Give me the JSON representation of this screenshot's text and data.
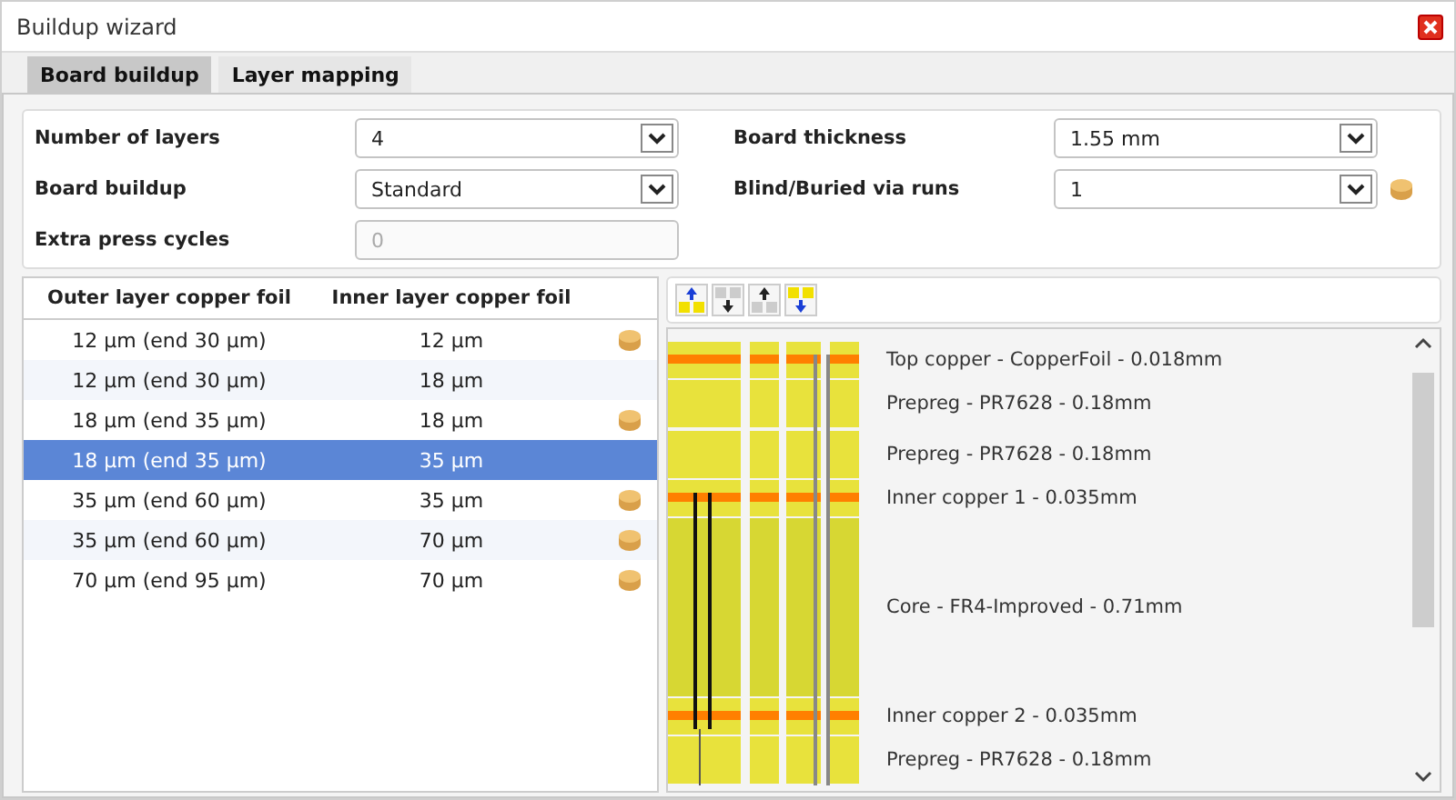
{
  "window": {
    "title": "Buildup wizard"
  },
  "tabs": [
    {
      "label": "Board buildup",
      "selected": true
    },
    {
      "label": "Layer mapping",
      "selected": false
    }
  ],
  "settings": [
    {
      "label": "Number of layers",
      "kind": "select",
      "value": "4",
      "disabled": false,
      "coin": false
    },
    {
      "label": "Board thickness",
      "kind": "select",
      "value": "1.55 mm",
      "disabled": false,
      "coin": false
    },
    {
      "label": "Board buildup",
      "kind": "select",
      "value": "Standard",
      "disabled": false,
      "coin": false
    },
    {
      "label": "Blind/Buried via runs",
      "kind": "select",
      "value": "1",
      "disabled": false,
      "coin": true
    },
    {
      "label": "Extra press cycles",
      "kind": "input",
      "value": "0",
      "disabled": true,
      "coin": false
    }
  ],
  "table": {
    "columns": [
      "Outer layer copper foil",
      "Inner layer copper foil"
    ],
    "rows": [
      {
        "cells": [
          "12 µm (end 30 µm)",
          "12 µm"
        ],
        "coin": true,
        "selected": false
      },
      {
        "cells": [
          "12 µm (end 30 µm)",
          "18 µm"
        ],
        "coin": false,
        "selected": false
      },
      {
        "cells": [
          "18 µm (end 35 µm)",
          "18 µm"
        ],
        "coin": true,
        "selected": false
      },
      {
        "cells": [
          "18 µm (end 35 µm)",
          "35 µm"
        ],
        "coin": false,
        "selected": true
      },
      {
        "cells": [
          "35 µm (end 60 µm)",
          "35 µm"
        ],
        "coin": true,
        "selected": false
      },
      {
        "cells": [
          "35 µm (end 60 µm)",
          "70 µm"
        ],
        "coin": true,
        "selected": false
      },
      {
        "cells": [
          "70 µm (end 95 µm)",
          "70 µm"
        ],
        "coin": true,
        "selected": false
      }
    ]
  },
  "stack": {
    "layers": [
      {
        "kind": "copper",
        "label": "Top copper - CopperFoil - 0.018mm"
      },
      {
        "kind": "prepreg",
        "label": "Prepreg - PR7628 - 0.18mm"
      },
      {
        "kind": "prepreg",
        "label": "Prepreg - PR7628 - 0.18mm"
      },
      {
        "kind": "copper",
        "label": "Inner copper 1 - 0.035mm"
      },
      {
        "kind": "core",
        "label": "Core - FR4-Improved - 0.71mm"
      },
      {
        "kind": "copper",
        "label": "Inner copper 2 - 0.035mm"
      },
      {
        "kind": "prepreg",
        "label": "Prepreg - PR7628 - 0.18mm"
      }
    ]
  }
}
